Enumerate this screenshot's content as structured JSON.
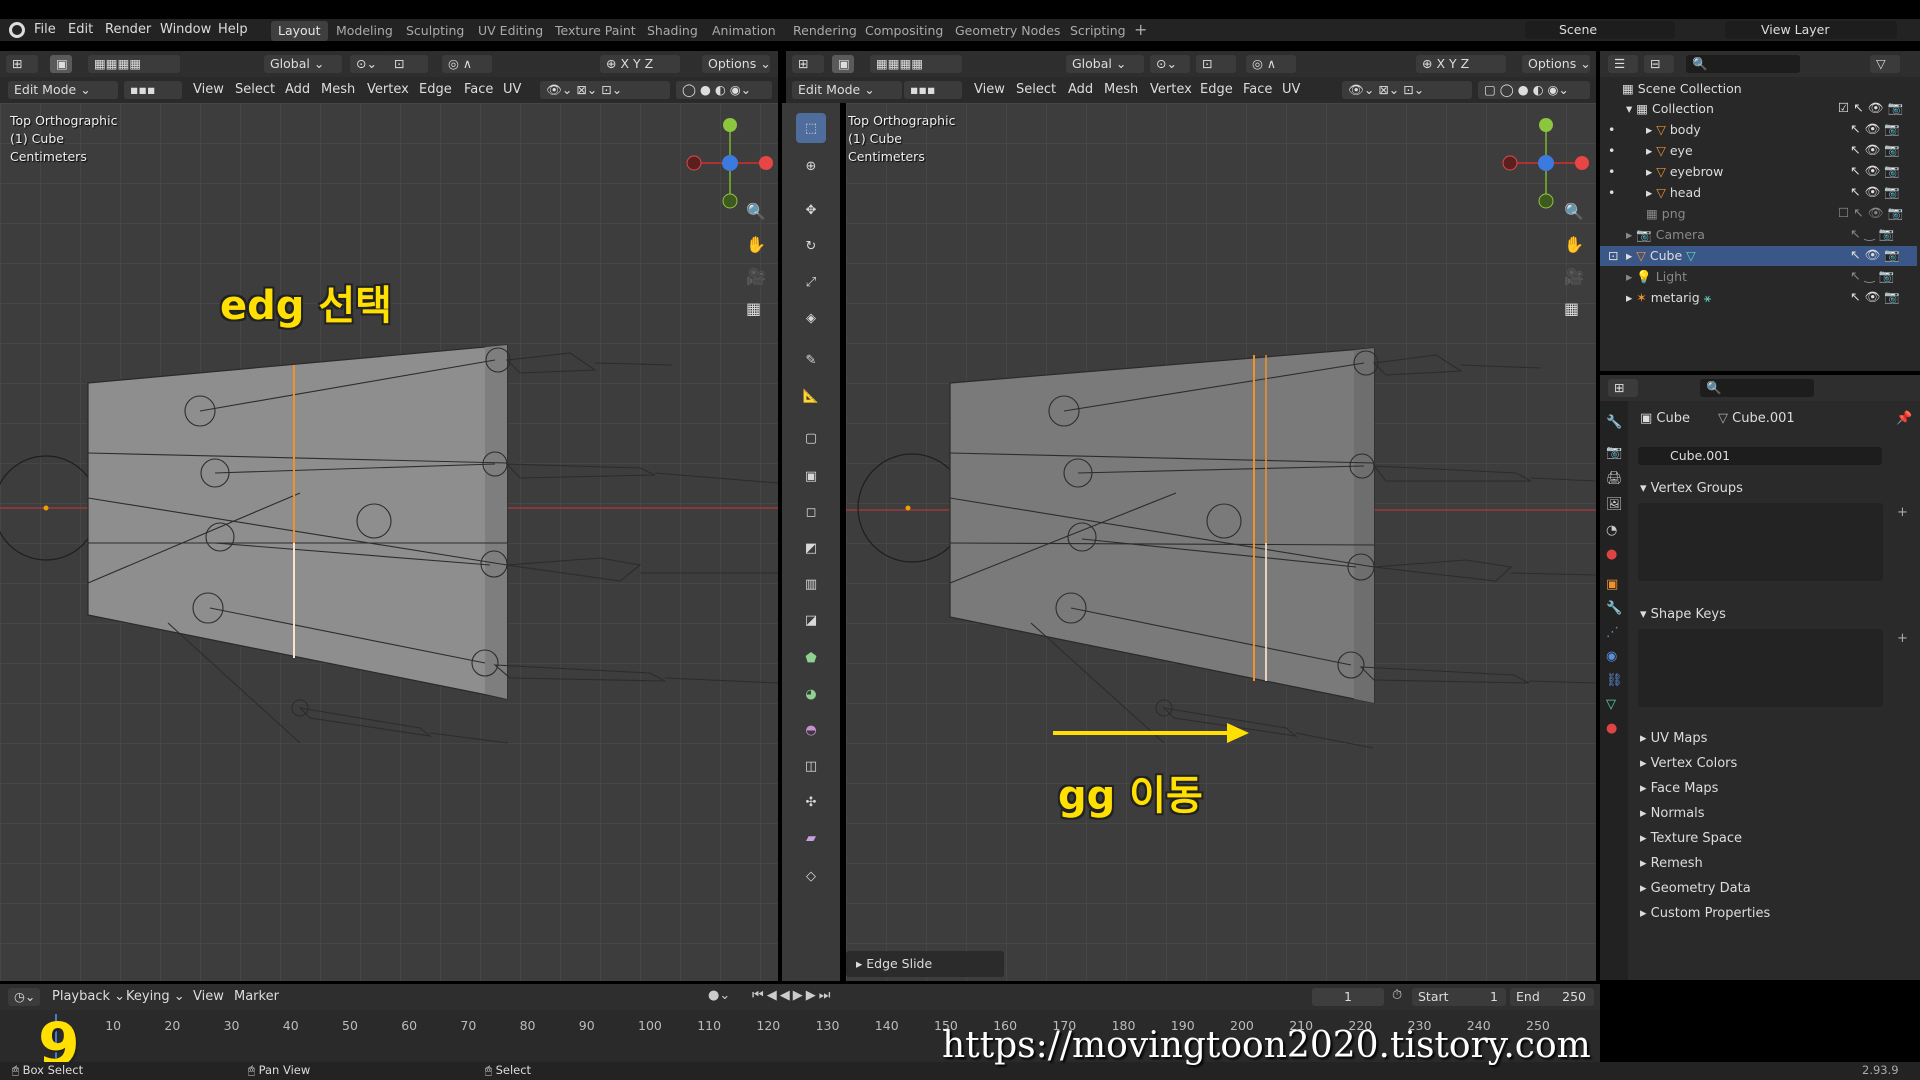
{
  "topbar": {
    "menu": [
      "File",
      "Edit",
      "Render",
      "Window",
      "Help"
    ],
    "workspaces": [
      "Layout",
      "Modeling",
      "Sculpting",
      "UV Editing",
      "Texture Paint",
      "Shading",
      "Animation",
      "Rendering",
      "Compositing",
      "Geometry Nodes",
      "Scripting"
    ],
    "active_workspace": "Layout",
    "scene": "Scene",
    "view_layer": "View Layer"
  },
  "left_view": {
    "transform": "Global",
    "options": "Options",
    "mode": "Edit Mode",
    "menus": [
      "View",
      "Select",
      "Add",
      "Mesh",
      "Vertex",
      "Edge",
      "Face",
      "UV"
    ],
    "overlay": [
      "Top Orthographic",
      "(1) Cube",
      "Centimeters"
    ],
    "annotation": "edg 선택"
  },
  "right_view": {
    "transform": "Global",
    "options": "Options",
    "mode": "Edit Mode",
    "menus": [
      "View",
      "Select",
      "Add",
      "Mesh",
      "Vertex",
      "Edge",
      "Face",
      "UV"
    ],
    "overlay": [
      "Top Orthographic",
      "(1) Cube",
      "Centimeters"
    ],
    "annotation": "gg 이동",
    "operator_panel": "Edge Slide"
  },
  "axes": {
    "x": "X",
    "y": "Y",
    "z": "Z"
  },
  "outliner": {
    "root": "Scene Collection",
    "items": [
      {
        "name": "Collection"
      },
      {
        "name": "body"
      },
      {
        "name": "eye"
      },
      {
        "name": "eyebrow"
      },
      {
        "name": "head"
      },
      {
        "name": "png"
      },
      {
        "name": "Camera"
      },
      {
        "name": "Cube"
      },
      {
        "name": "Light"
      },
      {
        "name": "metarig"
      }
    ]
  },
  "properties": {
    "object": "Cube",
    "mesh": "Cube.001",
    "mesh_field": "Cube.001",
    "sections": [
      "Vertex Groups",
      "Shape Keys",
      "UV Maps",
      "Vertex Colors",
      "Face Maps",
      "Normals",
      "Texture Space",
      "Remesh",
      "Geometry Data",
      "Custom Properties"
    ]
  },
  "timeline": {
    "menus": [
      "Playback",
      "Keying",
      "View",
      "Marker"
    ],
    "current_frame": "1",
    "start_label": "Start",
    "start": "1",
    "end_label": "End",
    "end": "250",
    "ticks": [
      "10",
      "20",
      "30",
      "40",
      "50",
      "60",
      "70",
      "80",
      "90",
      "100",
      "110",
      "120",
      "130",
      "140",
      "150",
      "160",
      "170",
      "180",
      "190",
      "200",
      "210",
      "220",
      "230",
      "240",
      "250"
    ],
    "big_frame": "9"
  },
  "statusbar": {
    "items": [
      "Box Select",
      "Pan View",
      "Select"
    ],
    "version": "2.93.9"
  },
  "watermark": "https://movingtoon2020.tistory.com",
  "colors": {
    "accent_orange": "#f0912c",
    "selection_blue": "#3a5788",
    "annotation_yellow": "#ffe000"
  }
}
